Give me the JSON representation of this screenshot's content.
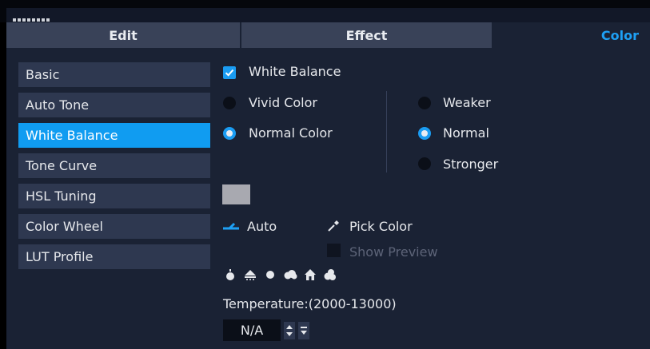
{
  "tabs": [
    {
      "label": "Edit"
    },
    {
      "label": "Effect"
    },
    {
      "label": "Color"
    }
  ],
  "sidebar": {
    "items": [
      {
        "label": "Basic"
      },
      {
        "label": "Auto Tone"
      },
      {
        "label": "White Balance"
      },
      {
        "label": "Tone Curve"
      },
      {
        "label": "HSL Tuning"
      },
      {
        "label": "Color Wheel"
      },
      {
        "label": "LUT Profile"
      }
    ],
    "active_index": 2
  },
  "white_balance": {
    "checkbox_label": "White Balance",
    "checked": true,
    "color_mode": {
      "options": [
        "Vivid Color",
        "Normal Color"
      ],
      "selected": "Normal Color"
    },
    "strength": {
      "options": [
        "Weaker",
        "Normal",
        "Stronger"
      ],
      "selected": "Normal"
    },
    "swatch_color": "#a8a9b0",
    "auto_label": "Auto",
    "pick_color_label": "Pick Color",
    "show_preview_label": "Show Preview",
    "presets": [
      "candle-icon",
      "fluorescent-icon",
      "sun-icon",
      "cloud-icon",
      "shade-house-icon",
      "overcast-icon"
    ],
    "temperature_label": "Temperature:(2000-13000)",
    "temperature_value": "N/A"
  },
  "colors": {
    "accent": "#1ea0f4",
    "panel_bg": "#1a2234",
    "sidebar_item_bg": "#2e3850",
    "active_item_bg": "#109cf1"
  }
}
